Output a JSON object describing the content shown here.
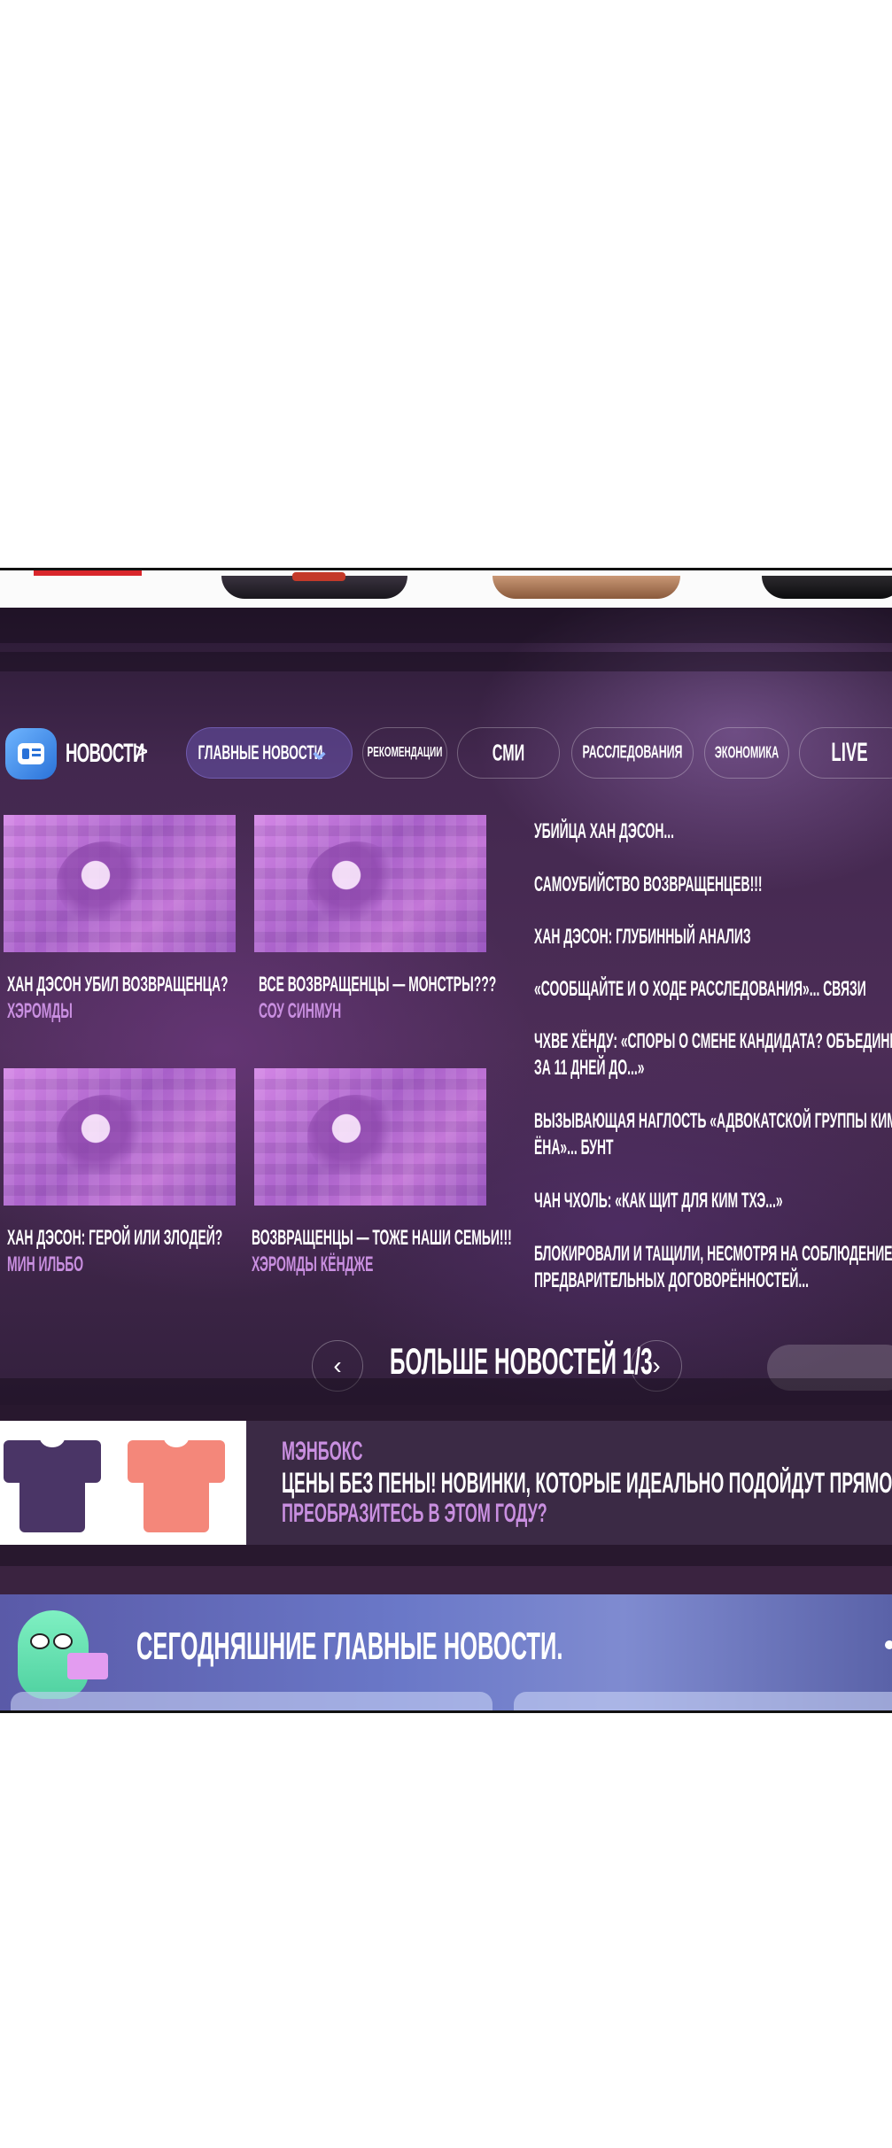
{
  "nav": {
    "logo_label": "НОВОСТИ",
    "logo_chevron": ">",
    "tabs": [
      {
        "label": "ГЛАВНЫЕ НОВОСТИ",
        "chevron": "⌄"
      },
      {
        "label": "РЕКОМЕНДАЦИИ"
      },
      {
        "label": "СМИ"
      },
      {
        "label": "РАССЛЕДОВАНИЯ"
      },
      {
        "label": "ЭКОНОМИКА"
      },
      {
        "label": "LIVE"
      }
    ]
  },
  "articles": [
    {
      "title": "ХАН ДЭСОН УБИЛ ВОЗВРАЩЕНЦА?",
      "author": "ХЭРОМДЫ"
    },
    {
      "title": "ВСЕ ВОЗВРАЩЕНЦЫ — МОНСТРЫ???",
      "author": "СОУ СИНМУН"
    },
    {
      "title": "ХАН ДЭСОН: ГЕРОЙ ИЛИ ЗЛОДЕЙ?",
      "author": "МИН ИЛЬБО"
    },
    {
      "title": "ВОЗВРАЩЕНЦЫ — ТОЖЕ НАШИ СЕМЬИ!!!",
      "author": "ХЭРОМДЫ КЁНДЖЕ"
    }
  ],
  "headlines": [
    [
      "УБИЙЦА ХАН ДЭСОН..."
    ],
    [
      "САМОУБИЙСТВО ВОЗВРАЩЕНЦЕВ!!!"
    ],
    [
      "ХАН ДЭСОН: ГЛУБИННЫЙ АНАЛИЗ"
    ],
    [
      "«СООБЩАЙТЕ И О ХОДЕ РАССЛЕДОВАНИЯ»... СВЯЗИ"
    ],
    [
      "ЧХВЕ ХЁНДУ: «СПОРЫ О СМЕНЕ КАНДИДАТА? ОБЪЕДИНЕНИЕ",
      "ЗА 11 ДНЕЙ ДО...»"
    ],
    [
      "ВЫЗЫВАЮЩАЯ НАГЛОСТЬ «АДВОКАТСКОЙ ГРУППЫ КИМ",
      "ЁНА»... БУНТ"
    ],
    [
      "ЧАН ЧХОЛЬ: «КАК ЩИТ ДЛЯ КИМ ТХЭ...»"
    ],
    [
      "БЛОКИРОВАЛИ И ТАЩИЛИ, НЕСМОТРЯ НА СОБЛЮДЕНИЕ",
      "ПРЕДВАРИТЕЛЬНЫХ ДОГОВОРЁННОСТЕЙ..."
    ]
  ],
  "more": {
    "label": "БОЛЬШЕ НОВОСТЕЙ 1/3",
    "prev": "‹",
    "next": "›"
  },
  "ad": {
    "brand": "МЭНБОКС",
    "line": "ЦЕНЫ БЕЗ ПЕНЫ! НОВИНКИ, КОТОРЫЕ ИДЕАЛЬНО ПОДОЙДУТ ПРЯМО СЕЙЧАС!",
    "cta": "ПРЕОБРАЗИТЕСЬ В ЭТОМ ГОДУ?",
    "shirt_colors": [
      "#4a3566",
      "#f4877a"
    ]
  },
  "today": {
    "title": "СЕГОДНЯШНИЕ ГЛАВНЫЕ НОВОСТИ."
  },
  "colors": {
    "accent": "#c98fe0",
    "logo": "#2a72d8",
    "panel": "#3a2340"
  }
}
